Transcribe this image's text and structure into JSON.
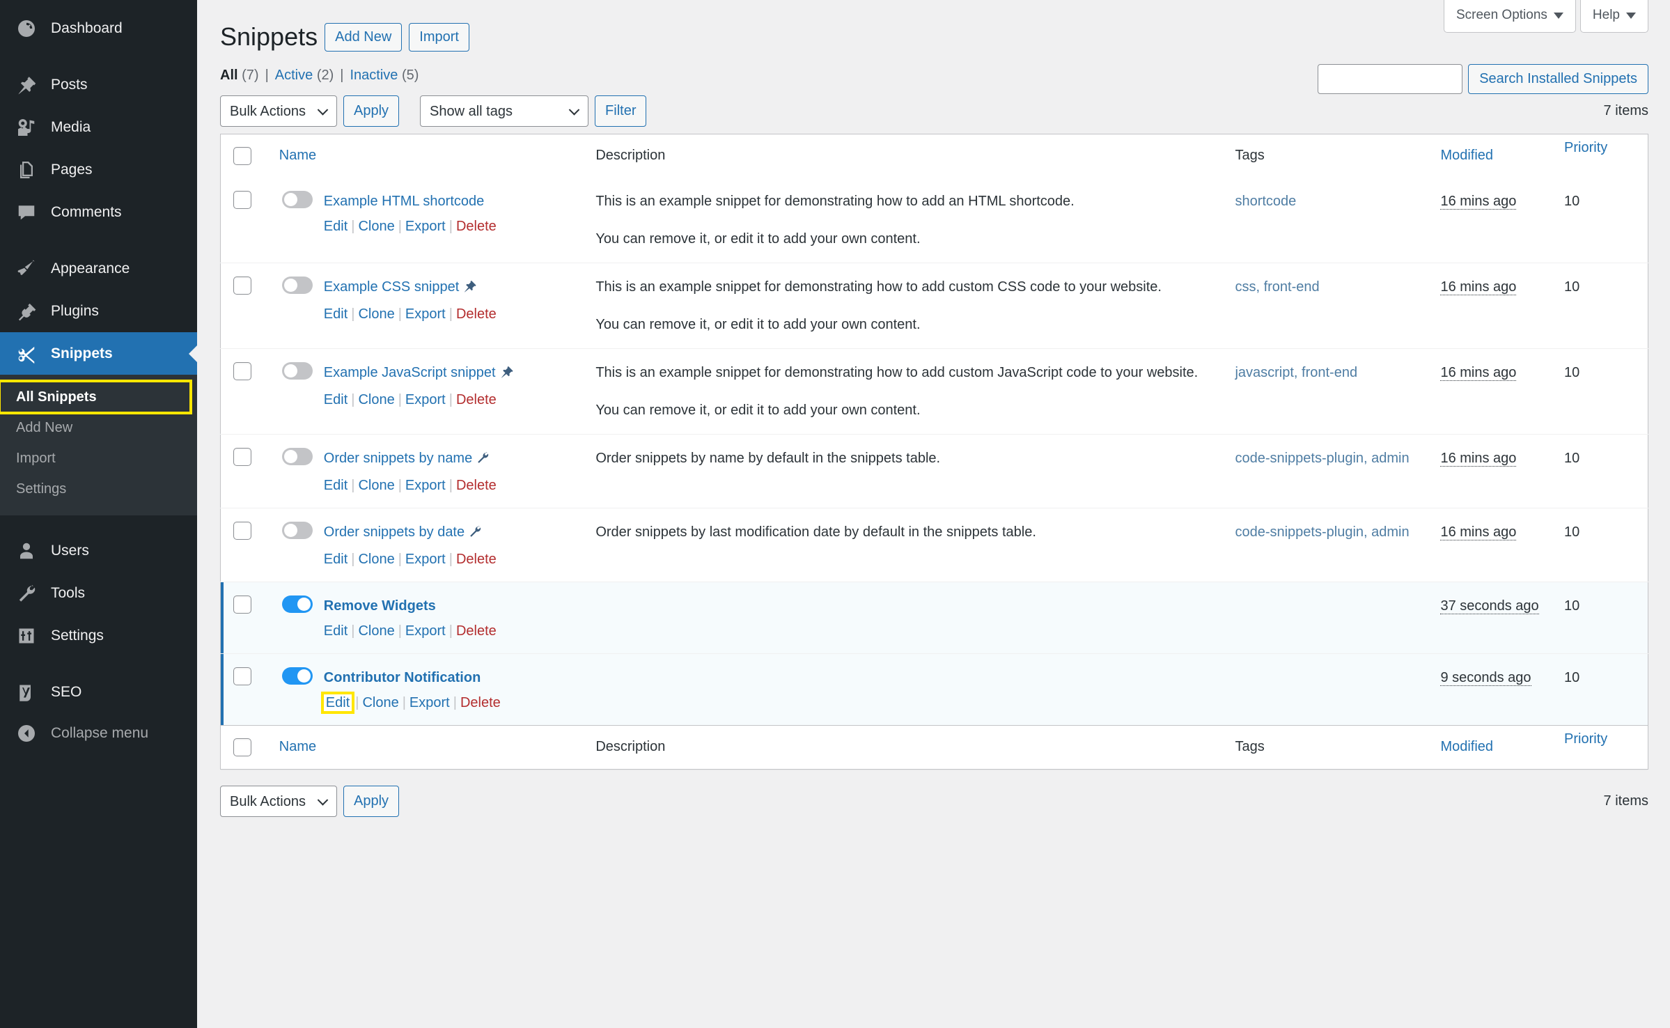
{
  "sidebar": {
    "items": [
      {
        "label": "Dashboard",
        "icon": "dashboard-icon",
        "key": "dashboard"
      },
      {
        "label": "Posts",
        "icon": "pin-icon",
        "key": "posts"
      },
      {
        "label": "Media",
        "icon": "media-icon",
        "key": "media"
      },
      {
        "label": "Pages",
        "icon": "pages-icon",
        "key": "pages"
      },
      {
        "label": "Comments",
        "icon": "comments-icon",
        "key": "comments"
      },
      {
        "label": "Appearance",
        "icon": "brush-icon",
        "key": "appearance"
      },
      {
        "label": "Plugins",
        "icon": "plug-icon",
        "key": "plugins"
      },
      {
        "label": "Snippets",
        "icon": "scissors-icon",
        "key": "snippets"
      },
      {
        "label": "Users",
        "icon": "user-icon",
        "key": "users"
      },
      {
        "label": "Tools",
        "icon": "wrench-icon",
        "key": "tools"
      },
      {
        "label": "Settings",
        "icon": "sliders-icon",
        "key": "settings"
      },
      {
        "label": "SEO",
        "icon": "yoast-icon",
        "key": "seo"
      }
    ],
    "submenu": [
      {
        "label": "All Snippets",
        "current": true
      },
      {
        "label": "Add New",
        "current": false
      },
      {
        "label": "Import",
        "current": false
      },
      {
        "label": "Settings",
        "current": false
      }
    ],
    "collapse_label": "Collapse menu",
    "collapse_icon": "collapse-arrow-icon"
  },
  "screen_meta": {
    "screen_options_label": "Screen Options",
    "help_label": "Help"
  },
  "header": {
    "title": "Snippets",
    "add_new_label": "Add New",
    "import_label": "Import"
  },
  "search": {
    "value": "",
    "placeholder": "",
    "submit_label": "Search Installed Snippets"
  },
  "status_links": [
    {
      "label": "All",
      "count": "(7)",
      "current": true
    },
    {
      "label": "Active",
      "count": "(2)",
      "current": false
    },
    {
      "label": "Inactive",
      "count": "(5)",
      "current": false
    }
  ],
  "tablenav": {
    "bulk_actions_label": "Bulk Actions",
    "apply_label": "Apply",
    "tags_filter_label": "Show all tags",
    "filter_label": "Filter",
    "items_count": "7 items"
  },
  "columns": {
    "name": "Name",
    "description": "Description",
    "tags": "Tags",
    "modified": "Modified",
    "priority": "Priority"
  },
  "row_actions": {
    "edit": "Edit",
    "clone": "Clone",
    "export": "Export",
    "delete": "Delete"
  },
  "colors": {
    "wp_blue": "#2271b1",
    "toggle_on": "#2196f3",
    "delete_red": "#b32d2e",
    "highlight_yellow": "#ffe600",
    "sidebar_bg": "#1d2327",
    "submenu_bg": "#2c3338"
  },
  "rows": [
    {
      "name": "Example HTML shortcode",
      "type_icon": "",
      "active": false,
      "bold": false,
      "description": [
        "This is an example snippet for demonstrating how to add an HTML shortcode.",
        "You can remove it, or edit it to add your own content."
      ],
      "tags": "shortcode",
      "modified": "16 mins ago",
      "priority": "10",
      "highlight_edit": false
    },
    {
      "name": "Example CSS snippet",
      "type_icon": "pushpin-icon",
      "active": false,
      "bold": false,
      "description": [
        "This is an example snippet for demonstrating how to add custom CSS code to your website.",
        "You can remove it, or edit it to add your own content."
      ],
      "tags": "css, front-end",
      "modified": "16 mins ago",
      "priority": "10",
      "highlight_edit": false
    },
    {
      "name": "Example JavaScript snippet",
      "type_icon": "pushpin-icon",
      "active": false,
      "bold": false,
      "description": [
        "This is an example snippet for demonstrating how to add custom JavaScript code to your website.",
        "You can remove it, or edit it to add your own content."
      ],
      "tags": "javascript, front-end",
      "modified": "16 mins ago",
      "priority": "10",
      "highlight_edit": false
    },
    {
      "name": "Order snippets by name",
      "type_icon": "wrench-icon",
      "active": false,
      "bold": false,
      "description": [
        "Order snippets by name by default in the snippets table."
      ],
      "tags": "code-snippets-plugin, admin",
      "modified": "16 mins ago",
      "priority": "10",
      "highlight_edit": false
    },
    {
      "name": "Order snippets by date",
      "type_icon": "wrench-icon",
      "active": false,
      "bold": false,
      "description": [
        "Order snippets by last modification date by default in the snippets table."
      ],
      "tags": "code-snippets-plugin, admin",
      "modified": "16 mins ago",
      "priority": "10",
      "highlight_edit": false
    },
    {
      "name": "Remove Widgets",
      "type_icon": "",
      "active": true,
      "bold": true,
      "description": [],
      "tags": "",
      "modified": "37 seconds ago",
      "priority": "10",
      "highlight_edit": false
    },
    {
      "name": "Contributor Notification",
      "type_icon": "",
      "active": true,
      "bold": true,
      "description": [],
      "tags": "",
      "modified": "9 seconds ago",
      "priority": "10",
      "highlight_edit": true
    }
  ]
}
